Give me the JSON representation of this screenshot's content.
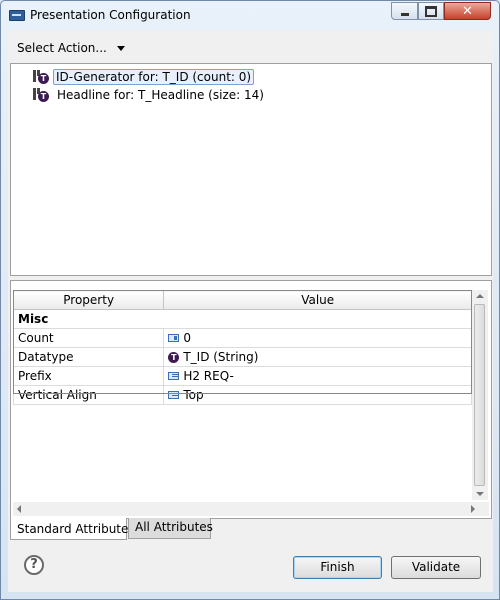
{
  "window": {
    "title": "Presentation Configuration",
    "close_glyph": "✕"
  },
  "toolbar": {
    "select_action_label": "Select Action..."
  },
  "tree": {
    "items": [
      {
        "label": "ID-Generator for: T_ID (count: 0)",
        "icon": "T",
        "selected": true
      },
      {
        "label": "Headline for: T_Headline (size: 14)",
        "icon": "T",
        "selected": false
      }
    ]
  },
  "properties": {
    "columns": [
      "Property",
      "Value"
    ],
    "category": "Misc",
    "rows": [
      {
        "property": "Count",
        "value": "0",
        "icon": "number-icon"
      },
      {
        "property": "Datatype",
        "value": "T_ID (String)",
        "icon": "type-icon",
        "icon_glyph": "T"
      },
      {
        "property": "Prefix",
        "value": "H2 REQ-",
        "icon": "text-list-icon"
      },
      {
        "property": "Vertical Align",
        "value": "Top",
        "icon": "text-list-icon"
      }
    ]
  },
  "tabs": [
    {
      "label": "Standard Attributes",
      "active": true
    },
    {
      "label": "All Attributes",
      "active": false
    }
  ],
  "buttons": {
    "help_glyph": "?",
    "finish": "Finish",
    "validate": "Validate"
  },
  "colors": {
    "accent": "#3c7fb1",
    "type_icon": "#3c1a52",
    "window_frame": "#d6e3f1"
  }
}
